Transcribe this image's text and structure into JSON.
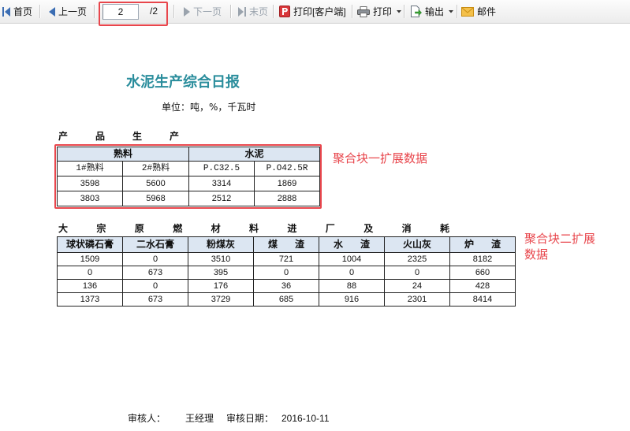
{
  "toolbar": {
    "first": {
      "label": "首页",
      "icon": "first-page-icon"
    },
    "prev": {
      "label": "上一页",
      "icon": "prev-page-icon"
    },
    "pager": {
      "current": "2",
      "total": "/2"
    },
    "next": {
      "label": "下一页",
      "icon": "next-page-icon",
      "disabled": true
    },
    "last": {
      "label": "末页",
      "icon": "last-page-icon",
      "disabled": true
    },
    "print_client": {
      "label": "打印[客户端]",
      "icon": "pdf-print-icon"
    },
    "print": {
      "label": "打印",
      "icon": "printer-icon"
    },
    "export": {
      "label": "输出",
      "icon": "export-icon"
    },
    "mail": {
      "label": "邮件",
      "icon": "mail-icon"
    }
  },
  "report": {
    "title": "水泥生产综合日报",
    "unit": "单位：吨，%，千瓦时",
    "section_product": "产品生产",
    "table_product": {
      "groups": [
        "熟料",
        "水泥"
      ],
      "columns": [
        "1#熟料",
        "2#熟料",
        "P.C32.5",
        "P.O42.5R"
      ],
      "rows": [
        [
          "3598",
          "5600",
          "3314",
          "1869"
        ],
        [
          "3803",
          "5968",
          "2512",
          "2888"
        ]
      ]
    },
    "section_materials": "大宗原燃材料进厂及消耗",
    "table_materials": {
      "columns": [
        "球状磷石膏",
        "二水石膏",
        "粉煤灰",
        "煤　渣",
        "水　渣",
        "火山灰",
        "炉　渣"
      ],
      "rows": [
        [
          "1509",
          "0",
          "3510",
          "721",
          "1004",
          "2325",
          "8182"
        ],
        [
          "0",
          "673",
          "395",
          "0",
          "0",
          "0",
          "660"
        ],
        [
          "136",
          "0",
          "176",
          "36",
          "88",
          "24",
          "428"
        ],
        [
          "1373",
          "673",
          "3729",
          "685",
          "916",
          "2301",
          "8414"
        ]
      ]
    },
    "footer": {
      "reviewer_label": "审核人：",
      "reviewer": "王经理",
      "date_label": "审核日期：",
      "date": "2016-10-11"
    }
  },
  "annotations": {
    "block1": "聚合块一扩展数据",
    "block2": "聚合块二扩展数据"
  },
  "colors": {
    "title": "#2a8d9c",
    "annotation": "#e8464c",
    "header_bg": "#dce6f2",
    "nav_icon": "#3b6db3",
    "disabled": "#9aa3ad"
  }
}
